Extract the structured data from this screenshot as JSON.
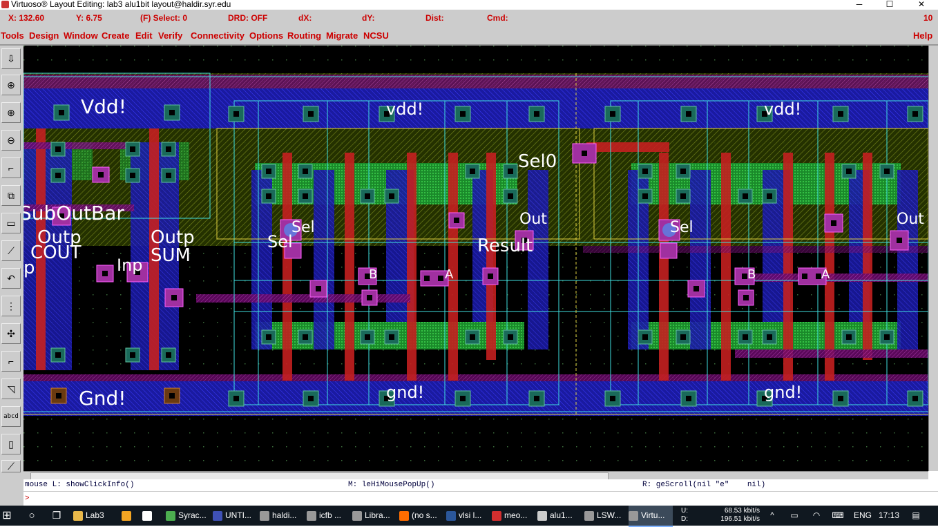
{
  "window": {
    "title": "Virtuoso® Layout Editing: lab3 alu1bit layout@haldir.syr.edu",
    "controls": [
      "─",
      "☐",
      "✕"
    ]
  },
  "status": {
    "x": "X: 132.60",
    "y": "Y: 6.75",
    "select": "(F) Select: 0",
    "drd": "DRD: OFF",
    "dx": "dX:",
    "dy": "dY:",
    "dist": "Dist:",
    "cmd": "Cmd:",
    "count": "10"
  },
  "menu": {
    "items": [
      "Tools",
      "Design",
      "Window",
      "Create",
      "Edit",
      "Verify",
      "Connectivity",
      "Options",
      "Routing",
      "Migrate",
      "NCSU"
    ],
    "help": "Help"
  },
  "toolbar": {
    "icons": [
      "save-icon",
      "fit-zoom-icon",
      "zoom-in-icon",
      "zoom-out-icon",
      "stretch-icon",
      "copy-icon",
      "move-icon",
      "ruler-icon",
      "undo-icon",
      "delete-icon",
      "property-icon",
      "path-icon",
      "polygon-icon",
      "label-icon",
      "instance-icon",
      "wire-icon"
    ],
    "label_tool": "abcd"
  },
  "layout": {
    "labels": {
      "vdd_left": "Vdd!",
      "vdd_mid": "vdd!",
      "vdd_right": "vdd!",
      "sel0": "Sel0",
      "suboutbar": "SubOutBar",
      "outp1": "Outp",
      "cout": "COUT",
      "inp": "Inp",
      "outp2": "Outp",
      "sum": "SUM",
      "p": "p",
      "sel_mid": "Sel",
      "sel_mid2": "Sel",
      "out_mid": "Out",
      "result": "Result",
      "b_mid": "B",
      "a_mid": "A",
      "sel_right": "Sel",
      "out_right": "Out",
      "b_right": "B",
      "a_right": "A",
      "gnd_left": "Gnd!",
      "gnd_mid": "gnd!",
      "gnd_right": "gnd!"
    }
  },
  "mouse_status": {
    "left": "mouse L: showClickInfo()",
    "middle": "M: leHiMousePopUp()",
    "right": "R: geScroll(nil \"e\"    nil)"
  },
  "command": {
    "prompt": ">"
  },
  "taskbar": {
    "items": [
      {
        "label": "Lab3",
        "color": "#e8b84a"
      },
      {
        "label": "",
        "color": "#f5a623"
      },
      {
        "label": "",
        "color": "#ffffff"
      },
      {
        "label": "Syrac...",
        "color": "#4caf50"
      },
      {
        "label": "UNTI...",
        "color": "#3f51b5"
      },
      {
        "label": "haldi...",
        "color": "#999999"
      },
      {
        "label": "icfb ...",
        "color": "#999999"
      },
      {
        "label": "Libra...",
        "color": "#999999"
      },
      {
        "label": "(no s...",
        "color": "#ff6d00"
      },
      {
        "label": "vlsi l...",
        "color": "#2b579a"
      },
      {
        "label": "meo...",
        "color": "#d32f2f"
      },
      {
        "label": "alu1...",
        "color": "#cccccc"
      },
      {
        "label": "LSW...",
        "color": "#999999"
      },
      {
        "label": "Virtu...",
        "color": "#999999"
      }
    ],
    "net_up": "68.53 kbit/s",
    "net_down": "196.51 kbit/s",
    "net_u": "U:",
    "net_d": "D:",
    "lang": "ENG",
    "time": "17:13"
  }
}
